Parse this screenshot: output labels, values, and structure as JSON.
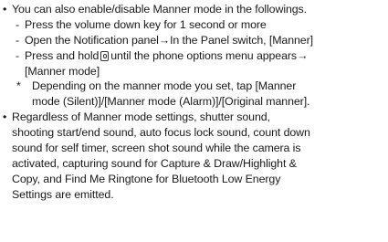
{
  "bullet_1": {
    "bullet": "•",
    "text": "You can also enable/disable Manner mode in the followings.",
    "items": [
      {
        "dash": "-",
        "text": "Press the volume down key for 1 second or more"
      },
      {
        "dash": "-",
        "text": "Open the Notification panel→In the Panel switch, [Manner]"
      },
      {
        "dash": "-",
        "text_before": "Press and hold",
        "icon": "power-key-icon",
        "text_after": "until the phone options menu appears→",
        "cont": "[Manner mode]"
      }
    ],
    "note": {
      "star": "*",
      "line1": "Depending on the manner mode you set, tap [Manner",
      "line2": "mode (Silent)]/[Manner mode (Alarm)]/[Original manner]."
    }
  },
  "bullet_2": {
    "bullet": "•",
    "lines": [
      "Regardless of Manner mode settings, shutter sound,",
      "shooting start/end sound, auto focus lock sound, count down",
      "sound for self timer, screen shot sound while the camera is",
      "activated, capturing sound for Capture & Draw/Highlight &",
      "Copy, and Find Me Ringtone for Bluetooth Low Energy",
      "Settings are emitted."
    ]
  }
}
